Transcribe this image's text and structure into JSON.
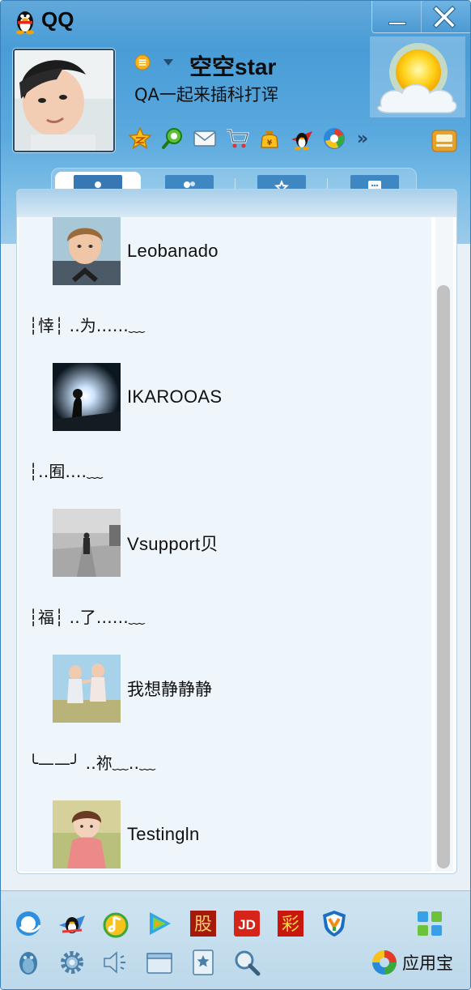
{
  "window": {
    "title": "QQ",
    "min_glyph": "—",
    "close_glyph": "✕"
  },
  "profile": {
    "nickname": "空空star",
    "signature": "QA一起来插科打诨",
    "status_icon": "status-busy-icon"
  },
  "toolbar": {
    "icons": [
      "qzone-star-icon",
      "search-p-icon",
      "mail-icon",
      "shopping-cart-icon",
      "wallet-bag-icon",
      "qq-penguin-game-icon",
      "browser-icon"
    ],
    "more": "»"
  },
  "tabs": [
    "contacts",
    "groups",
    "favorites",
    "recent-chats"
  ],
  "contacts": [
    {
      "name": "Leobanado",
      "latin": true
    },
    {
      "name": "IKAROOAS",
      "latin": true
    },
    {
      "name": "Vsupport贝",
      "latin": true
    },
    {
      "name": "我想静静静",
      "latin": false
    },
    {
      "name": "Testingln",
      "latin": true
    }
  ],
  "group_labels": [
    "┆悻┆ ‥为‥‥‥﹏",
    "┆‥囿‥‥﹏",
    "┆福┆ ‥了‥‥‥﹏",
    "╰——╯ ‥祢﹏‥﹏"
  ],
  "bottom": {
    "row1": [
      "qq-browser-icon",
      "qq-game-icon",
      "qq-music-icon",
      "qq-video-icon",
      "stock-icon",
      "jd-icon",
      "lottery-icon",
      "qq-guard-icon"
    ],
    "row1_text": {
      "stock": "股",
      "jd": "JD",
      "lottery": "彩"
    },
    "row2": [
      "contacts-penguin-icon",
      "settings-gear-icon",
      "volume-icon",
      "folder-icon",
      "bookmark-star-icon",
      "search-icon"
    ],
    "appstore_label": "应用宝"
  },
  "colors": {
    "header_blue": "#4b9ad3",
    "list_bg": "#eef6fb",
    "accent": "#3677b4"
  }
}
